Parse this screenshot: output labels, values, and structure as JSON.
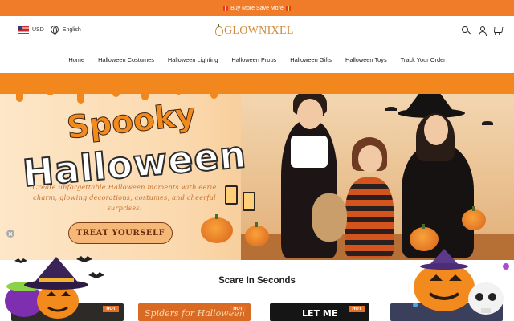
{
  "promo": {
    "text": "Buy More Save More"
  },
  "header": {
    "currency": "USD",
    "language": "English",
    "logo": "GLOWNIXEL",
    "icons": [
      "search-icon",
      "user-icon",
      "cart-icon"
    ]
  },
  "nav": {
    "items": [
      {
        "label": "Home"
      },
      {
        "label": "Halloween Costumes"
      },
      {
        "label": "Halloween Lighting"
      },
      {
        "label": "Halloween Props"
      },
      {
        "label": "Halloween Gifts"
      },
      {
        "label": "Halloween Toys"
      },
      {
        "label": "Track Your Order"
      }
    ]
  },
  "hero": {
    "title_line1": "Spooky",
    "title_line2": "Halloween",
    "subtitle": "Create unforgettable Halloween moments with eerie charm, glowing decorations, costumes, and cheerful surprises.",
    "cta": "TREAT YOURSELF"
  },
  "section": {
    "title": "Scare In Seconds",
    "cards": [
      {
        "badge": "HOT",
        "caption": ""
      },
      {
        "badge": "HOT",
        "caption": "Spiders for Halloween"
      },
      {
        "badge": "HOT",
        "caption": "LET ME"
      },
      {
        "badge": "",
        "caption": ""
      }
    ]
  },
  "colors": {
    "promo_bar": "#f07c2a",
    "logo": "#d08a3a",
    "hero_orange": "#f28a1d",
    "cta_bg": "#f6b879"
  }
}
